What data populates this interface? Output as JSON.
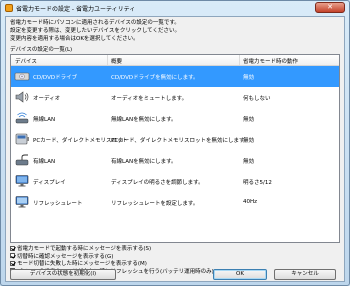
{
  "window": {
    "title": "省電力モードの設定 - 省電力ユーティリティ",
    "close": "✕"
  },
  "intro": {
    "line1": "省電力モード時にパソコンに適用されるデバイスの設定の一覧です。",
    "line2": "設定を変更する際は、変更したいデバイスをクリックしてください。",
    "line3": "変更内容を適用する場合はOKを選択してください。"
  },
  "list_label": "デバイスの設定の一覧(L)",
  "columns": {
    "device": "デバイス",
    "summary": "概要",
    "action": "省電力モード時の動作"
  },
  "rows": [
    {
      "name": "CD/DVDドライブ",
      "summary": "CD/DVDドライブを無効にします。",
      "action": "無効",
      "icon": "cd-dvd-drive-icon"
    },
    {
      "name": "オーディオ",
      "summary": "オーディオをミュートします。",
      "action": "何もしない",
      "icon": "audio-speaker-icon"
    },
    {
      "name": "無線LAN",
      "summary": "無線LANを無効にします。",
      "action": "無効",
      "icon": "wireless-lan-icon"
    },
    {
      "name": "PCカード、ダイレクトメモリスロット",
      "summary": "PCカード、ダイレクトメモリスロットを無効にします。",
      "action": "無効",
      "icon": "pc-card-icon"
    },
    {
      "name": "有線LAN",
      "summary": "有線LANを無効にします。",
      "action": "無効",
      "icon": "wired-lan-icon"
    },
    {
      "name": "ディスプレイ",
      "summary": "ディスプレイの明るさを調節します。",
      "action": "明るさ5/12",
      "icon": "display-icon"
    },
    {
      "name": "リフレッシュレート",
      "summary": "リフレッシュレートを設定します。",
      "action": "40Hz",
      "icon": "refresh-rate-icon"
    }
  ],
  "options": [
    {
      "label": "省電力モードで起動する時にメッセージを表示する(S)",
      "checked": true
    },
    {
      "label": "切替時に確認メッセージを表示する(G)",
      "checked": true
    },
    {
      "label": "モード切替に失敗した時にメッセージを表示する(M)",
      "checked": true
    },
    {
      "label": "パソコンの省電力モードが少ない時にリフレッシュを行う(バッテリ運用時のみ)(A)",
      "checked": false
    }
  ],
  "buttons": {
    "reset": "デバイスの状態を初期化(I)",
    "ok": "OK",
    "cancel": "キャンセル"
  },
  "colors": {
    "selected_row": "#3399ff"
  }
}
